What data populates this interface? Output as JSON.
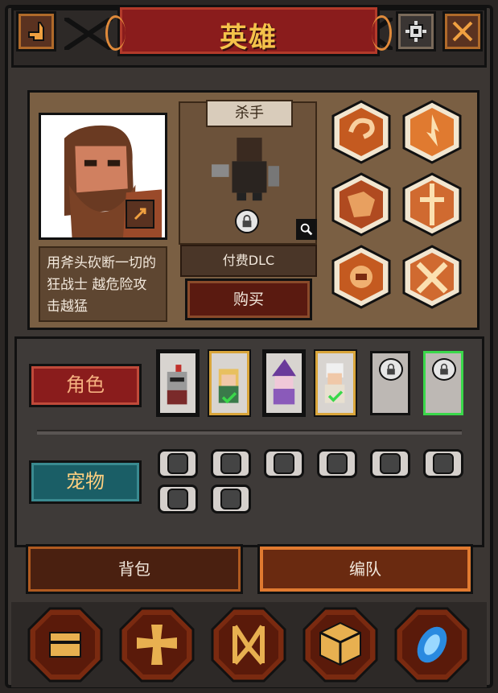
{
  "header": {
    "title": "英雄",
    "back_icon": "back-arrow-icon",
    "settings_icon": "gear-icon",
    "close_icon": "close-icon"
  },
  "hero": {
    "class_name": "杀手",
    "description": "用斧头砍断一切的狂战士 越危险攻击越猛",
    "dlc_label": "付费DLC",
    "buy_label": "购买",
    "skills": [
      "swirl-skill-icon",
      "flame-skill-icon",
      "beast-skill-icon",
      "split-skill-icon",
      "rage-skill-icon",
      "cross-slash-skill-icon"
    ]
  },
  "roster": {
    "role_tab": "角色",
    "pet_tab": "宠物",
    "heroes": [
      {
        "name": "knight",
        "state": "owned"
      },
      {
        "name": "elf",
        "state": "equipped"
      },
      {
        "name": "witch",
        "state": "owned"
      },
      {
        "name": "priest",
        "state": "equipped"
      },
      {
        "name": "locked-hero-1",
        "state": "locked"
      },
      {
        "name": "locked-hero-2",
        "state": "locked-selected"
      }
    ],
    "pets_count": 8
  },
  "tabs": {
    "bag": "背包",
    "team": "编队"
  },
  "nav": [
    "chest-icon",
    "cross-icon",
    "rune-icon",
    "box-icon",
    "portal-icon"
  ],
  "colors": {
    "accent_red": "#8a1c1c",
    "gold": "#f4c24a",
    "teal": "#1a5e66",
    "select_green": "#3ad84a"
  }
}
